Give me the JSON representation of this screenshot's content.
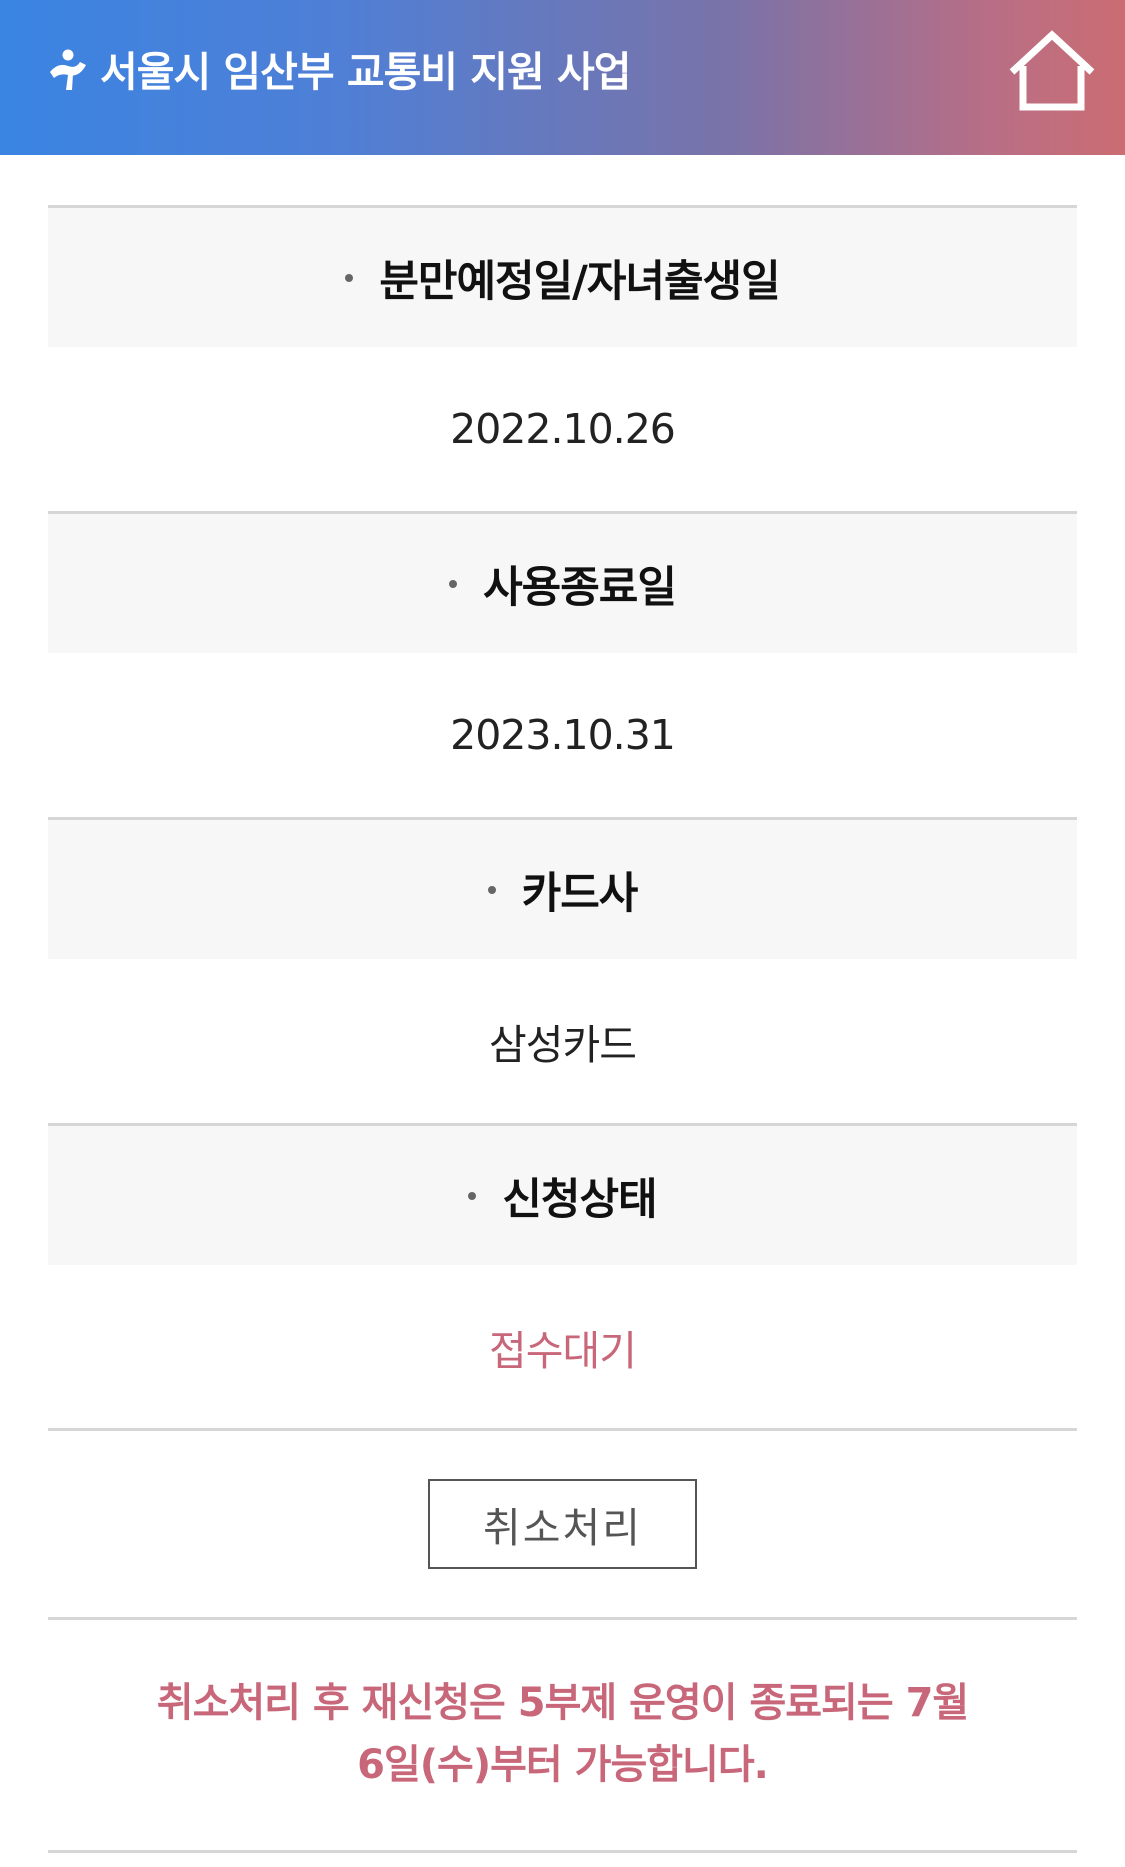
{
  "header": {
    "title": "서울시 임산부 교통비 지원 사업",
    "logo_icon": "mother-child-logo-icon",
    "home_icon": "home-icon"
  },
  "fields": [
    {
      "label": "분만예정일/자녀출생일",
      "value": "2022.10.26"
    },
    {
      "label": "사용종료일",
      "value": "2023.10.31"
    },
    {
      "label": "카드사",
      "value": "삼성카드"
    },
    {
      "label": "신청상태",
      "value": "접수대기"
    }
  ],
  "actions": {
    "cancel_label": "취소처리"
  },
  "notice": {
    "line1": "취소처리 후 재신청은 5부제 운영이 종료되는 7월",
    "line2": "6일(수)부터 가능합니다."
  },
  "colors": {
    "header_start": "#3a84e2",
    "header_end": "#cb6d72",
    "accent": "#c8677a",
    "label_bg": "#f7f7f7",
    "divider": "#d6d6d6"
  }
}
